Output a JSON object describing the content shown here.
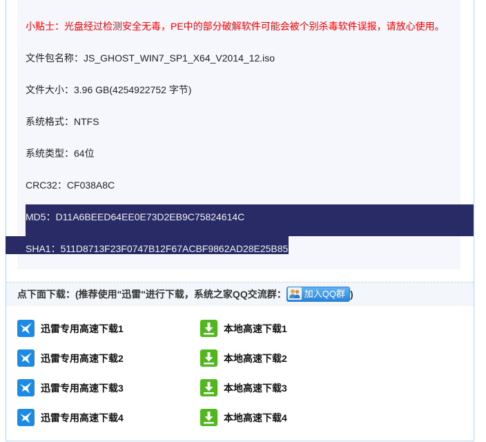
{
  "notice": "小贴士：光盘经过检测安全无毒，PE中的部分破解软件可能会被个别杀毒软件误报，请放心使用。",
  "file_info": {
    "package_name": {
      "label": "文件包名称：",
      "value": "JS_GHOST_WIN7_SP1_X64_V2014_12.iso"
    },
    "file_size": {
      "label": "文件大小：",
      "value": "3.96 GB(4254922752 字节)"
    },
    "file_system": {
      "label": "系统格式：",
      "value": "NTFS"
    },
    "system_type": {
      "label": "系统类型：",
      "value": "64位"
    },
    "crc32": {
      "label": "CRC32：",
      "value": "CF038A8C"
    },
    "md5": {
      "label": "MD5：",
      "value": "D11A6BEED64EE0E73D2EB9C75824614C"
    },
    "sha1": {
      "label": "SHA1：",
      "value": "511D8713F23F0747B12F67ACBF9862AD28E25B85"
    }
  },
  "download_header": {
    "text": "点下面下载：(推荐使用\"迅雷\"进行下载，系统之家QQ交流群：",
    "qq_button_label": "加入QQ群",
    "closing": ")"
  },
  "downloads": {
    "thunder": [
      "迅雷专用高速下载1",
      "迅雷专用高速下载2",
      "迅雷专用高速下载3",
      "迅雷专用高速下载4"
    ],
    "local": [
      "本地高速下载1",
      "本地高速下载2",
      "本地高速下载3",
      "本地高速下载4"
    ]
  },
  "icons": {
    "thunder": "thunder-bird-icon",
    "local": "download-arrow-icon",
    "qq": "qq-group-icon"
  },
  "colors": {
    "notice": "#ff0000",
    "text": "#222222",
    "panel": "#f6f6fd",
    "border": "#b9d6ec",
    "selection": "#282b66",
    "thunder": "#1b8be6",
    "local": "#52b71e"
  }
}
